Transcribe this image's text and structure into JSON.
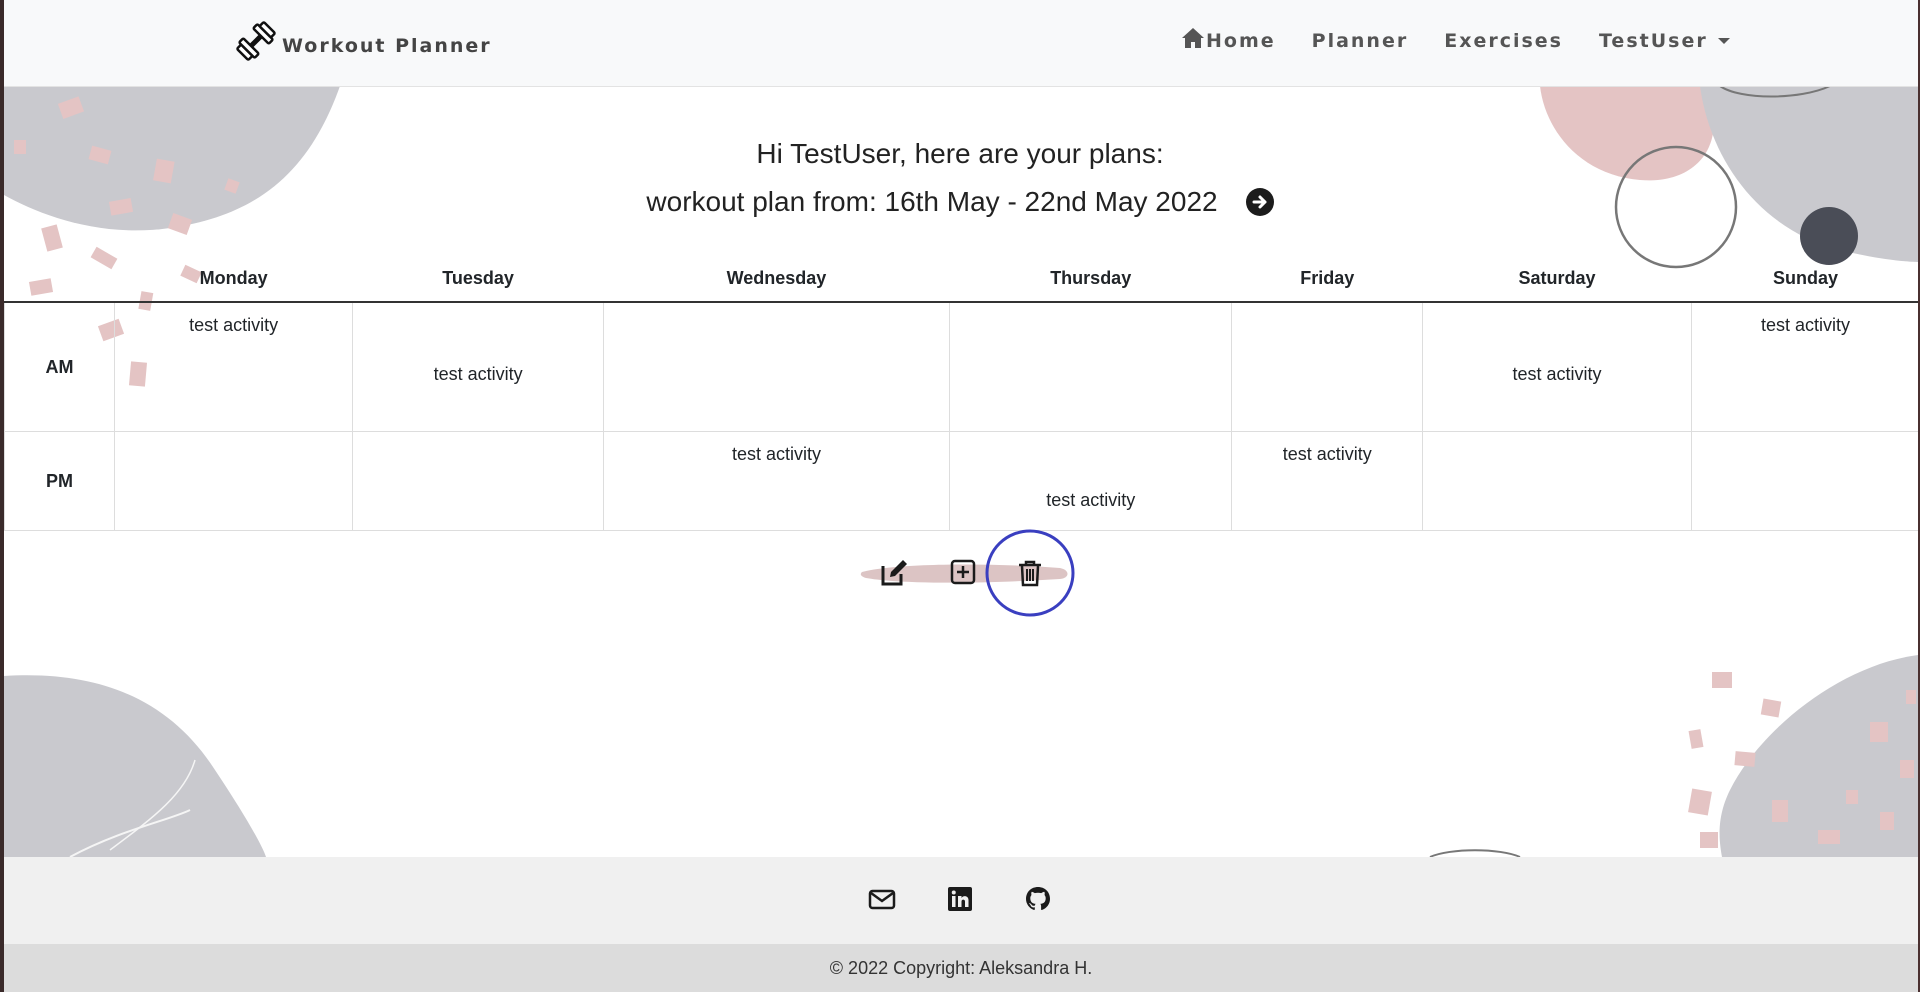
{
  "navbar": {
    "brand": "Workout Planner",
    "links": [
      {
        "label": "Home",
        "icon": "home-icon"
      },
      {
        "label": "Planner"
      },
      {
        "label": "Exercises"
      },
      {
        "label": "TestUser",
        "dropdown": true
      }
    ]
  },
  "main": {
    "greeting": "Hi TestUser, here are your plans:",
    "plan_range": "workout plan from: 16th May - 22nd May 2022",
    "next_icon": "arrow-right-circle-icon",
    "table": {
      "days": [
        "Monday",
        "Tuesday",
        "Wednesday",
        "Thursday",
        "Friday",
        "Saturday",
        "Sunday"
      ],
      "rows": [
        {
          "label": "AM",
          "cells": [
            {
              "top": "test activity",
              "bottom": ""
            },
            {
              "top": "",
              "bottom": "test activity"
            },
            {
              "top": "",
              "bottom": ""
            },
            {
              "top": "",
              "bottom": ""
            },
            {
              "top": "",
              "bottom": ""
            },
            {
              "top": "",
              "bottom": "test activity"
            },
            {
              "top": "test activity",
              "bottom": ""
            }
          ]
        },
        {
          "label": "PM",
          "cells": [
            {
              "top": "",
              "bottom": ""
            },
            {
              "top": "",
              "bottom": ""
            },
            {
              "top": "test activity",
              "bottom": ""
            },
            {
              "top": "",
              "bottom": "test activity"
            },
            {
              "top": "test activity",
              "bottom": ""
            },
            {
              "top": "",
              "bottom": ""
            },
            {
              "top": "",
              "bottom": ""
            }
          ]
        }
      ]
    },
    "actions": [
      {
        "name": "edit-plan-button",
        "icon": "edit-icon"
      },
      {
        "name": "add-plan-button",
        "icon": "plus-square-icon"
      },
      {
        "name": "delete-plan-button",
        "icon": "trash-icon"
      }
    ]
  },
  "footer": {
    "icons": [
      "envelope-icon",
      "linkedin-icon",
      "github-icon"
    ],
    "copyright": "© 2022 Copyright: Aleksandra H."
  },
  "colors": {
    "navbar_bg": "#f8f9fa",
    "decor_gray": "#c9c9ce",
    "decor_pink": "#e4c4c4",
    "dark_dot": "#4a4d57",
    "highlight_circle": "#3a3fc0",
    "footer_bg": "#f0f0f0",
    "footer_bottom_bg": "#dcdcdc"
  }
}
